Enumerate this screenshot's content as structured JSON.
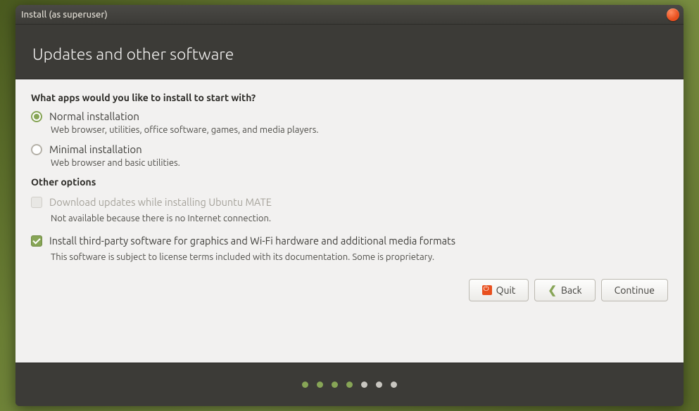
{
  "titlebar": {
    "title": "Install (as superuser)"
  },
  "header": {
    "title": "Updates and other software"
  },
  "content": {
    "question": "What apps would you like to install to start with?",
    "options": {
      "normal": {
        "label": "Normal installation",
        "desc": "Web browser, utilities, office software, games, and media players.",
        "checked": true
      },
      "minimal": {
        "label": "Minimal installation",
        "desc": "Web browser and basic utilities.",
        "checked": false
      }
    },
    "other_title": "Other options",
    "checkboxes": {
      "download_updates": {
        "label": "Download updates while installing Ubuntu MATE",
        "desc": "Not available because there is no Internet connection.",
        "checked": false,
        "disabled": true
      },
      "third_party": {
        "label": "Install third-party software for graphics and Wi-Fi hardware and additional media formats",
        "desc": "This software is subject to license terms included with its documentation. Some is proprietary.",
        "checked": true,
        "disabled": false
      }
    }
  },
  "buttons": {
    "quit": "Quit",
    "back": "Back",
    "continue": "Continue"
  },
  "progress": {
    "total": 7,
    "current": 4
  }
}
